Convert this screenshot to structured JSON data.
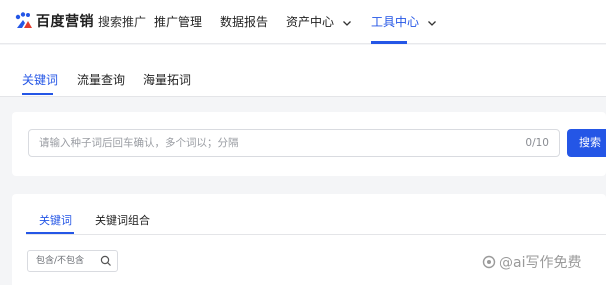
{
  "header": {
    "logo_text": "百度营销",
    "logo_sub": "搜索推广",
    "nav": [
      {
        "label": "推广管理"
      },
      {
        "label": "数据报告"
      },
      {
        "label": "资产中心"
      },
      {
        "label": "工具中心"
      }
    ]
  },
  "subtabs": [
    {
      "label": "关键词"
    },
    {
      "label": "流量查询"
    },
    {
      "label": "海量拓词"
    }
  ],
  "search": {
    "placeholder": "请输入种子词后回车确认，多个词以；分隔",
    "count": "0/10",
    "button_label": "搜索"
  },
  "results": {
    "tabs": [
      {
        "label": "关键词"
      },
      {
        "label": "关键词组合"
      }
    ],
    "filter_placeholder": "包含/不包含"
  },
  "watermark": {
    "text": "@ai写作免费"
  },
  "colors": {
    "accent": "#2456e6",
    "background": "#f4f5f7"
  }
}
